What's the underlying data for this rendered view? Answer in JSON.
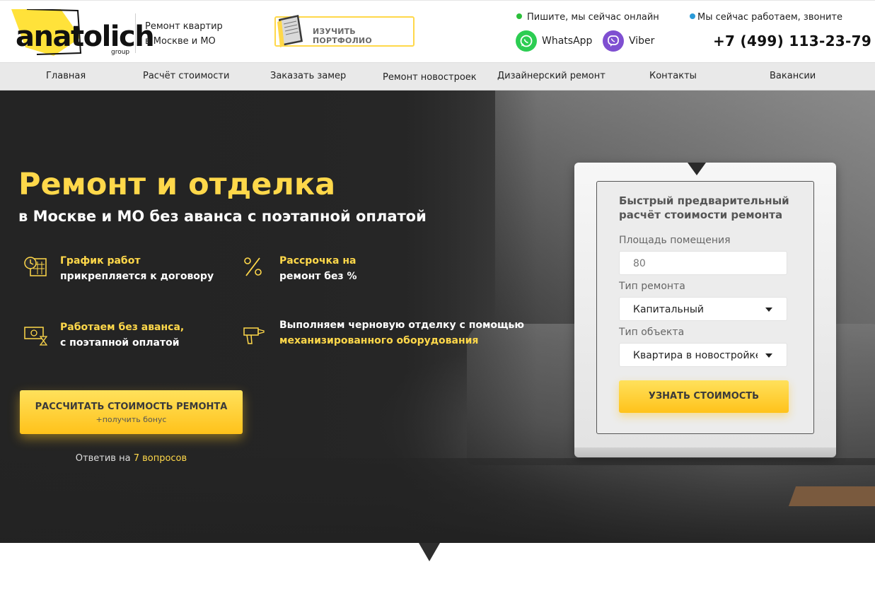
{
  "header": {
    "logo_text": "anatolich",
    "logo_sub": "group",
    "tagline_line1": "Ремонт квартир",
    "tagline_line2": "в Москве и МО",
    "portfolio_label": "ИЗУЧИТЬ ПОРТФОЛИО",
    "online_text": "Пишите, мы сейчас онлайн",
    "working_text": "Мы сейчас работаем, звоните",
    "whatsapp_label": "WhatsApp",
    "viber_label": "Viber",
    "phone": "+7 (499) 113-23-79",
    "colors": {
      "online_dot": "#2bbf3a",
      "working_dot": "#2a9ad8",
      "accent": "#ffd84a"
    }
  },
  "nav": {
    "items": [
      "Главная",
      "Расчёт стоимости",
      "Заказать замер",
      "Ремонт новостроек",
      "Дизайнерский ремонт",
      "Контакты",
      "Вакансии"
    ]
  },
  "hero": {
    "title": "Ремонт и отделка",
    "subtitle": "в Москве и МО без аванса с поэтапной оплатой",
    "features": [
      {
        "icon": "calendar-clock-icon",
        "line1": "График работ",
        "line2": "прикрепляется к договору"
      },
      {
        "icon": "percent-icon",
        "line1": "Рассрочка на",
        "line2": "ремонт без %"
      },
      {
        "icon": "cash-hourglass-icon",
        "line1": "Работаем без аванса,",
        "line2": "с поэтапной оплатой"
      },
      {
        "icon": "drill-icon",
        "line1": "Выполняем черновую отделку с помощью",
        "line2": "механизированного оборудования"
      }
    ],
    "cta_label": "РАССЧИТАТЬ СТОИМОСТЬ РЕМОНТА",
    "cta_sub": "+получить бонус",
    "answer_prefix": "Ответив на",
    "answer_link": "7 вопросов"
  },
  "calc": {
    "title": "Быстрый предварительный расчёт стоимости ремонта",
    "area_label": "Площадь помещения",
    "area_value": "80",
    "repair_type_label": "Тип ремонта",
    "repair_type_value": "Капитальный",
    "object_type_label": "Тип объекта",
    "object_type_value": "Квартира в новостройке",
    "submit_label": "УЗНАТЬ СТОИМОСТЬ"
  }
}
